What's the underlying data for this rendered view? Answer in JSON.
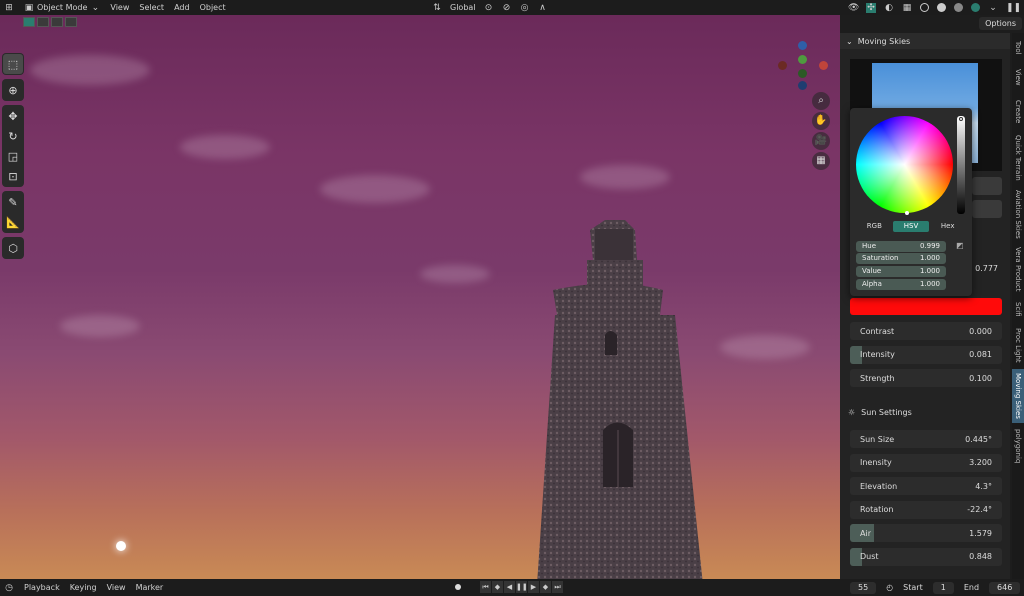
{
  "header": {
    "menus": [
      "View",
      "Select",
      "Add",
      "Object"
    ],
    "mode_label": "Object Mode",
    "orientation_label": "Global",
    "options_label": "Options"
  },
  "viewport": {},
  "panel": {
    "title": "Moving Skies",
    "rows_top": [
      {
        "label": "Contrast",
        "value": "0.000",
        "fill": 0
      },
      {
        "label": "Intensity",
        "value": "0.081",
        "fill": 0.08
      },
      {
        "label": "Strength",
        "value": "0.100",
        "fill": 0
      }
    ],
    "partial_value": "0.777",
    "sun_header": "Sun Settings",
    "rows_sun": [
      {
        "label": "Sun Size",
        "value": "0.445°",
        "fill": 0
      },
      {
        "label": "Inensity",
        "value": "3.200",
        "fill": 0
      },
      {
        "label": "Elevation",
        "value": "4.3°",
        "fill": 0
      },
      {
        "label": "Rotation",
        "value": "-22.4°",
        "fill": 0
      },
      {
        "label": "Air",
        "value": "1.579",
        "fill": 0.16
      },
      {
        "label": "Dust",
        "value": "0.848",
        "fill": 0.08
      }
    ],
    "color_value": "#ff0a0a"
  },
  "picker": {
    "modes": [
      "RGB",
      "HSV",
      "Hex"
    ],
    "active_mode": "HSV",
    "fields": [
      {
        "label": "Hue",
        "value": "0.999"
      },
      {
        "label": "Saturation",
        "value": "1.000"
      },
      {
        "label": "Value",
        "value": "1.000"
      },
      {
        "label": "Alpha",
        "value": "1.000"
      }
    ]
  },
  "side_tabs": [
    "Tool",
    "View",
    "Create",
    "Quick Terrain",
    "Aviation Skies",
    "Vera Product",
    "Scifi",
    "Proc Light",
    "Moving Skies",
    "polygoniq"
  ],
  "active_side_tab": "Moving Skies",
  "timeline": {
    "menus": [
      "Playback",
      "Keying",
      "View",
      "Marker"
    ],
    "current_frame": "55",
    "start_label": "Start",
    "start_value": "1",
    "end_label": "End",
    "end_value": "646"
  },
  "colors": {
    "accent": "#2a7d6f",
    "active_tab": "#3a5f78",
    "selected_color": "#ff0a0a"
  }
}
